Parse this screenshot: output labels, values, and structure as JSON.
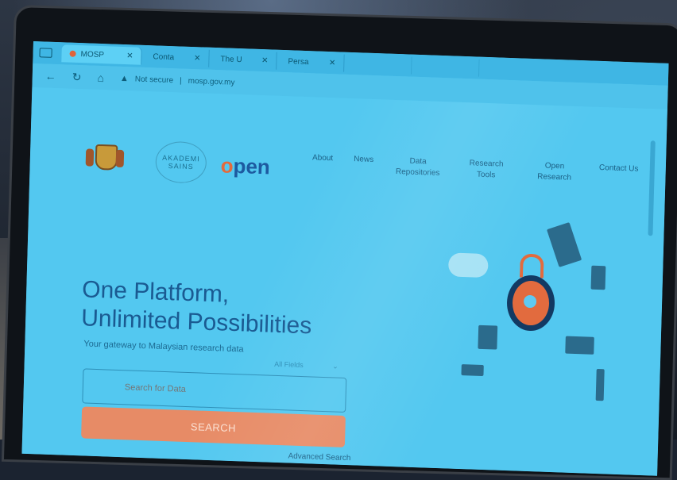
{
  "browser": {
    "tabs": [
      {
        "label": "MOSP",
        "active": true
      },
      {
        "label": "Conta",
        "active": false
      },
      {
        "label": "The U",
        "active": false
      },
      {
        "label": "Persa",
        "active": false
      }
    ],
    "url_warning": "Not secure",
    "url": "mosp.gov.my"
  },
  "page": {
    "nav": [
      "About",
      "News",
      "Data Repositories",
      "Research Tools",
      "Open Research",
      "Contact Us"
    ],
    "logos": {
      "akademi_line1": "AKADEMI",
      "akademi_line2": "SAINS",
      "open_text": "pen",
      "open_o": "o"
    },
    "hero": {
      "title_line1": "One Platform,",
      "title_line2": "Unlimited Possibilities",
      "subtitle": "Your gateway to Malaysian research data"
    },
    "search": {
      "placeholder": "Search for Data",
      "fields_label": "All Fields",
      "button_label": "SEARCH",
      "advanced_label": "Advanced Search"
    }
  },
  "colors": {
    "screen_bg": "#53c8f0",
    "accent": "#e78b66",
    "brand_blue": "#1a5a92"
  },
  "icons": [
    "window-icon",
    "back-arrow-icon",
    "reload-icon",
    "home-icon",
    "warning-icon",
    "lock-illustration-icon",
    "cloud-icon"
  ]
}
